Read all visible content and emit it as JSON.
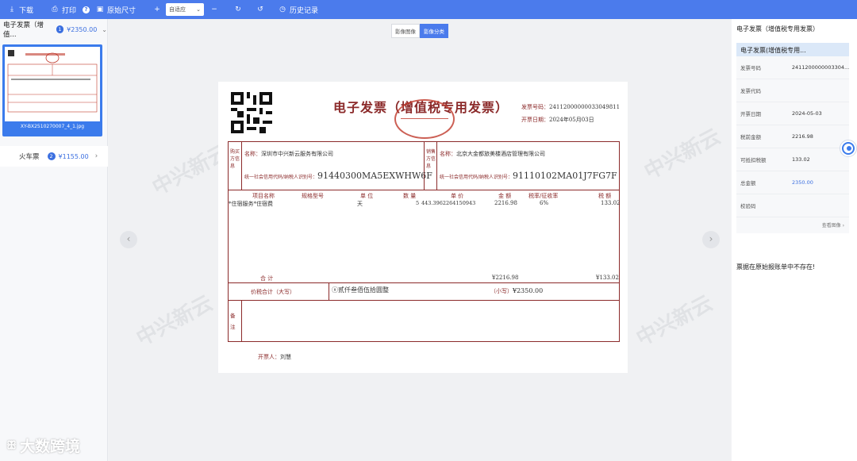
{
  "toolbar": {
    "download": "下载",
    "print": "打印",
    "original_size": "原始尺寸",
    "zoom": "自适应",
    "history": "历史记录"
  },
  "sidebar": {
    "invoice_category": "电子发票（增值...",
    "invoice_count": "1",
    "invoice_amount": "¥2350.00",
    "thumb_caption": "XY-BX2510270007_4_1.jpg",
    "train_category": "火车票",
    "train_count": "2",
    "train_amount": "¥1155.00"
  },
  "viewer": {
    "tab_image": "影像图像",
    "tab_classify": "影像分类",
    "watermark_logo": "中兴新云"
  },
  "invoice": {
    "title": "电子发票（增值税专用发票）",
    "number_label": "发票号码：",
    "number": "24112000000033049811",
    "date_label": "开票日期：",
    "date": "2024年05月03日",
    "buyer_section": "购买方信息",
    "seller_section": "销售方信息",
    "buyer_name_label": "名称：",
    "buyer_name": "深圳市中兴新云服务有限公司",
    "seller_name_label": "名称：",
    "seller_name": "北京大金都旅美楼酒店管理有限公司",
    "tax_id_label": "统一社会信用代码/纳税人识别号：",
    "buyer_tax_id": "91440300MA5EXWHW6F",
    "seller_tax_id": "91110102MA01J7FG7F",
    "col_item": "项目名称",
    "col_spec": "规格型号",
    "col_unit": "单 位",
    "col_qty": "数 量",
    "col_price": "单 价",
    "col_amount": "金 额",
    "col_rate": "税率/征收率",
    "col_tax": "税 额",
    "item_name": "*住宿服务*住宿费",
    "item_unit": "天",
    "item_qty": "5",
    "item_price": "443.3962264150943",
    "item_amount": "2216.98",
    "item_rate": "6%",
    "item_tax": "133.02",
    "total_label": "合 计",
    "total_amount": "¥2216.98",
    "total_tax": "¥133.02",
    "grand_label": "价税合计（大写）",
    "grand_words": "ⓧ贰仟叁佰伍拾圆整",
    "grand_small": "（小写）",
    "grand_num": "¥2350.00",
    "remarks_label": "备注",
    "issuer_label": "开票人：",
    "issuer": "刘慧"
  },
  "details": {
    "header": "电子发票（增值税专用发票）",
    "card_title": "电子发票(增值税专用...",
    "rows": [
      {
        "label": "发票号码",
        "value": "2411200000003304..."
      },
      {
        "label": "发票代码",
        "value": ""
      },
      {
        "label": "开票日期",
        "value": "2024-05-03"
      },
      {
        "label": "税前金额",
        "value": "2216.98"
      },
      {
        "label": "可抵扣税额",
        "value": "133.02"
      },
      {
        "label": "总金额",
        "value": "2350.00"
      },
      {
        "label": "校验码",
        "value": ""
      }
    ],
    "more": "查看图像 ›",
    "notice": "票据在原始报账单中不存在!"
  },
  "brand": {
    "text": "大数跨境"
  }
}
